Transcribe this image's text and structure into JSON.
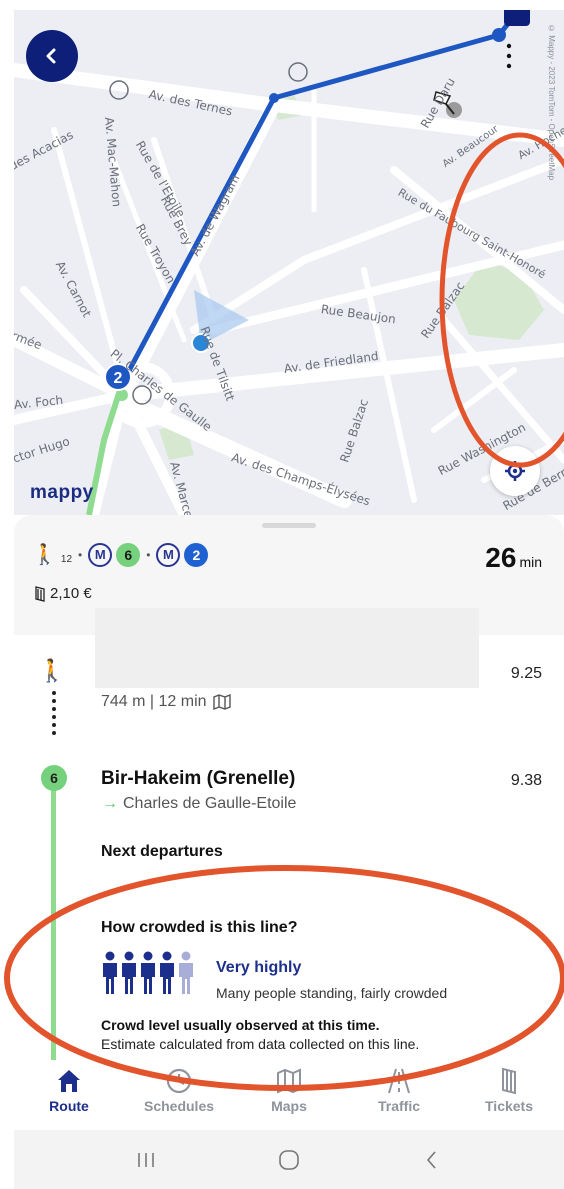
{
  "map": {
    "back_icon": "chevron-left-icon",
    "logo": "mappy",
    "copyright": "© Mappy - 2023 TomTom - OpenStreetMap",
    "streets": [
      {
        "name": "Av. des Ternes"
      },
      {
        "name": "Av. Mac-Mahon"
      },
      {
        "name": "Rue de l'Etoile"
      },
      {
        "name": "Rue Brey"
      },
      {
        "name": "Rue Troyon"
      },
      {
        "name": "Av. de Wagram"
      },
      {
        "name": "des Acacias"
      },
      {
        "name": "Av. Carnot"
      },
      {
        "name": "rmée"
      },
      {
        "name": "Pl. Charles de Gaulle"
      },
      {
        "name": "Av. Foch"
      },
      {
        "name": "ictor Hugo"
      },
      {
        "name": "Rue de Tilsitt"
      },
      {
        "name": "Rue Beaujon"
      },
      {
        "name": "Av. de Friedland"
      },
      {
        "name": "Rue Balzac"
      },
      {
        "name": "Av. des Champs-Élysées"
      },
      {
        "name": "Av. Marceau"
      },
      {
        "name": "Rue Washington"
      },
      {
        "name": "Rue du Faubourg Saint-Honoré"
      },
      {
        "name": "Av. Beaucour"
      },
      {
        "name": "Av. Hoche"
      },
      {
        "name": "Rue Daru"
      },
      {
        "name": "Rue Balzac"
      },
      {
        "name": "Rue de Berri"
      }
    ],
    "route_badge": "2"
  },
  "summary": {
    "walk_minutes": "12",
    "metro_label": "M",
    "line_a": "6",
    "line_b": "2",
    "duration_value": "26",
    "duration_unit": "min",
    "price": "2,10 €"
  },
  "walk_step": {
    "meta": "744 m | 12 min",
    "time": "9.25"
  },
  "metro_step": {
    "line": "6",
    "station": "Bir-Hakeim (Grenelle)",
    "direction": "Charles de Gaulle-Etoile",
    "time": "9.38",
    "next_departures": "Next departures"
  },
  "crowd": {
    "question": "How crowded is this line?",
    "level": "Very highly",
    "level_fraction": 0.8,
    "description": "Many people standing, fairly crowded",
    "observed": "Crowd level usually observed at this time.",
    "estimate": "Estimate calculated from data collected on this line.",
    "filled_color": "#1d2f8c",
    "empty_color": "#a9aed8"
  },
  "nav": [
    {
      "label": "Route",
      "icon": "home-icon",
      "active": true
    },
    {
      "label": "Schedules",
      "icon": "clock-icon",
      "active": false
    },
    {
      "label": "Maps",
      "icon": "map-icon",
      "active": false
    },
    {
      "label": "Traffic",
      "icon": "road-icon",
      "active": false
    },
    {
      "label": "Tickets",
      "icon": "ticket-icon",
      "active": false
    }
  ],
  "colors": {
    "brand_navy": "#0d1f78",
    "line_6": "#76d17d",
    "line_2": "#1f61d1",
    "annotation": "#e2542c"
  }
}
